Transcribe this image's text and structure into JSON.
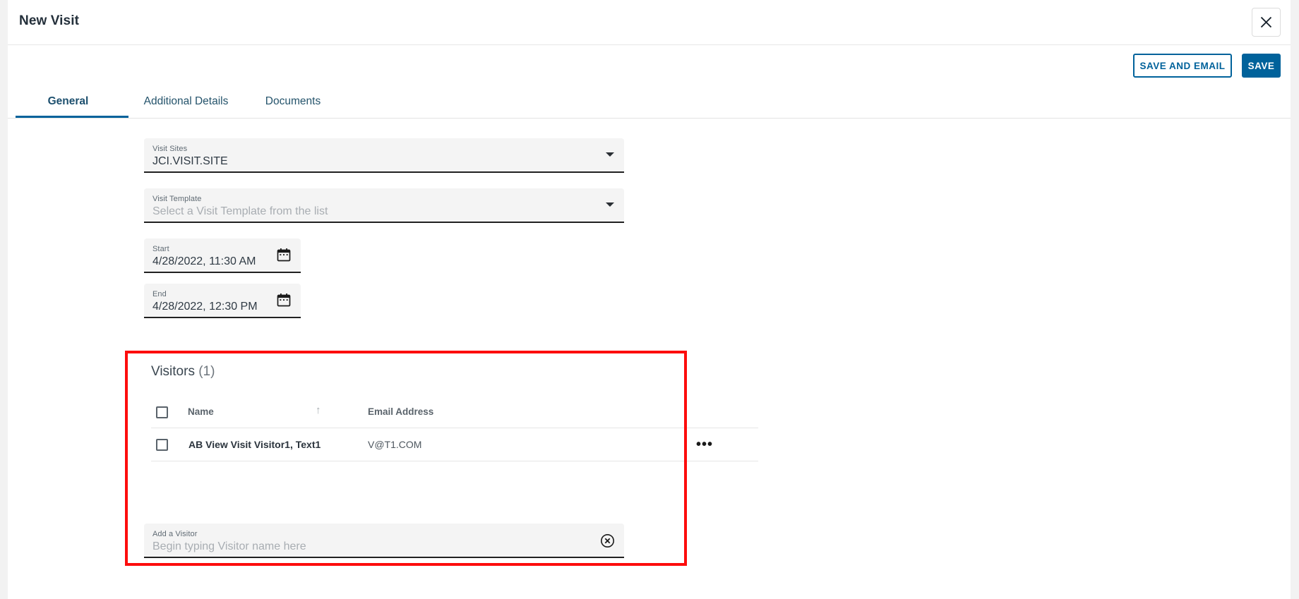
{
  "window": {
    "title": "New Visit",
    "close_icon": "close-icon"
  },
  "actions": {
    "save_and_email_label": "SAVE AND EMAIL",
    "save_label": "SAVE",
    "primary_color": "#00629b"
  },
  "tabs": [
    {
      "label": "General",
      "active": true
    },
    {
      "label": "Additional Details",
      "active": false
    },
    {
      "label": "Documents",
      "active": false
    }
  ],
  "form": {
    "visit_sites": {
      "label": "Visit Sites",
      "value": "JCI.VISIT.SITE",
      "is_placeholder": false,
      "icon": "chevron-down-icon"
    },
    "visit_template": {
      "label": "Visit Template",
      "value": "Select a Visit Template from the list",
      "is_placeholder": true,
      "icon": "chevron-down-icon"
    },
    "start": {
      "label": "Start",
      "value": "4/28/2022, 11:30 AM",
      "icon": "calendar-icon"
    },
    "end": {
      "label": "End",
      "value": "4/28/2022, 12:30 PM",
      "icon": "calendar-icon"
    }
  },
  "visitors": {
    "title": "Visitors",
    "count_label": "(1)",
    "highlight_color": "#fd0d0d",
    "columns": [
      {
        "label": "Name",
        "sorted": true,
        "sort_icon": "sort-ascending-arrow-icon"
      },
      {
        "label": "Email Address",
        "sorted": false
      }
    ],
    "rows": [
      {
        "selected": false,
        "name": "AB View Visit Visitor1, Text1",
        "email": "V@T1.COM",
        "menu_icon": "overflow-menu-icon",
        "menu_label": "•••"
      }
    ],
    "add_visitor": {
      "label": "Add a Visitor",
      "placeholder": "Begin typing Visitor name here",
      "value": "",
      "clear_icon": "clear-circle-icon"
    }
  }
}
